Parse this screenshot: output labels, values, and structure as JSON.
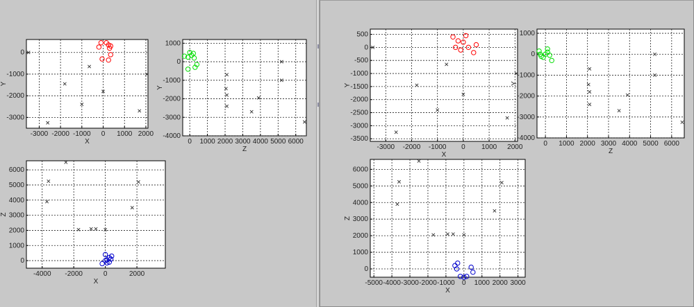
{
  "colors": {
    "background": "#c8c8c8",
    "axes_bg": "#ffffff",
    "grid": "#222222",
    "cross": "#333333",
    "series_xy": "#ff0000",
    "series_zy": "#00dd00",
    "series_xz": "#0000cc"
  },
  "chart_data": [
    {
      "panel": "left",
      "type": "scatter",
      "xlabel": "X",
      "ylabel": "Y",
      "xlim": [
        -3600,
        2100
      ],
      "ylim": [
        -3500,
        600
      ],
      "xticks": [
        -3000,
        -2000,
        -1000,
        0,
        1000,
        2000
      ],
      "xtick_labels": [
        "-3000",
        "-2000",
        "-1000",
        "0",
        "1000",
        "2000"
      ],
      "yticks": [
        -3000,
        -2000,
        -1000,
        0
      ],
      "ytick_labels": [
        "-3000",
        "-2000",
        "-1000",
        "0"
      ],
      "grid": true,
      "series": [
        {
          "marker": "x",
          "points": [
            [
              -3500,
              0
            ],
            [
              -2600,
              -3250
            ],
            [
              -1800,
              -1450
            ],
            [
              -1000,
              -2400
            ],
            [
              -650,
              -650
            ],
            [
              0,
              -1800
            ],
            [
              1700,
              -2700
            ],
            [
              2050,
              -1000
            ]
          ]
        },
        {
          "marker": "o",
          "color": "#ff0000",
          "points": [
            [
              -200,
              250
            ],
            [
              -100,
              450
            ],
            [
              150,
              450
            ],
            [
              250,
              350
            ],
            [
              350,
              300
            ],
            [
              300,
              200
            ],
            [
              350,
              -100
            ],
            [
              250,
              -350
            ],
            [
              -50,
              -300
            ]
          ]
        }
      ]
    },
    {
      "panel": "left",
      "type": "scatter",
      "xlabel": "Z",
      "ylabel": "Y",
      "xlim": [
        -400,
        6600
      ],
      "ylim": [
        -4000,
        1200
      ],
      "xticks": [
        0,
        1000,
        2000,
        3000,
        4000,
        5000,
        6000
      ],
      "xtick_labels": [
        "0",
        "1000",
        "2000",
        "3000",
        "4000",
        "5000",
        "6000"
      ],
      "yticks": [
        -4000,
        -3000,
        -2000,
        -1000,
        0,
        1000
      ],
      "ytick_labels": [
        "-4000",
        "-3000",
        "-2000",
        "-1000",
        "0",
        "1000"
      ],
      "grid": true,
      "series": [
        {
          "marker": "x",
          "points": [
            [
              2100,
              -700
            ],
            [
              2050,
              -1450
            ],
            [
              2100,
              -1800
            ],
            [
              2100,
              -2400
            ],
            [
              3500,
              -2700
            ],
            [
              3900,
              -1950
            ],
            [
              5200,
              0
            ],
            [
              5200,
              -1000
            ],
            [
              6500,
              -3250
            ]
          ]
        },
        {
          "marker": "o",
          "color": "#00dd00",
          "points": [
            [
              -300,
              300
            ],
            [
              -100,
              250
            ],
            [
              0,
              500
            ],
            [
              100,
              350
            ],
            [
              200,
              450
            ],
            [
              250,
              200
            ],
            [
              -100,
              -400
            ],
            [
              300,
              -300
            ],
            [
              400,
              -150
            ]
          ]
        }
      ]
    },
    {
      "panel": "left",
      "type": "scatter",
      "xlabel": "X",
      "ylabel": "Z",
      "xlim": [
        -5000,
        3800
      ],
      "ylim": [
        -500,
        6600
      ],
      "xticks": [
        -4000,
        -2000,
        0,
        2000
      ],
      "xtick_labels": [
        "-4000",
        "-2000",
        "0",
        "2000"
      ],
      "yticks": [
        0,
        1000,
        2000,
        3000,
        4000,
        5000,
        6000
      ],
      "ytick_labels": [
        "0",
        "1000",
        "2000",
        "3000",
        "4000",
        "5000",
        "6000"
      ],
      "grid": true,
      "series": [
        {
          "marker": "x",
          "points": [
            [
              -3600,
              5250
            ],
            [
              -3700,
              3900
            ],
            [
              -2500,
              6500
            ],
            [
              -1700,
              2050
            ],
            [
              -900,
              2100
            ],
            [
              -600,
              2100
            ],
            [
              0,
              2050
            ],
            [
              1700,
              3500
            ],
            [
              2100,
              5200
            ]
          ]
        },
        {
          "marker": "o",
          "color": "#0000cc",
          "points": [
            [
              -200,
              -200
            ],
            [
              0,
              400
            ],
            [
              0,
              0
            ],
            [
              100,
              50
            ],
            [
              250,
              -100
            ],
            [
              350,
              100
            ],
            [
              400,
              300
            ],
            [
              250,
              200
            ],
            [
              100,
              -150
            ]
          ]
        }
      ]
    },
    {
      "panel": "right",
      "type": "scatter",
      "xlabel": "X",
      "ylabel": "Y",
      "xlim": [
        -3600,
        2100
      ],
      "ylim": [
        -3600,
        700
      ],
      "xticks": [
        -3000,
        -2000,
        -1000,
        0,
        1000,
        2000
      ],
      "xtick_labels": [
        "-3000",
        "-2000",
        "-1000",
        "0",
        "1000",
        "2000"
      ],
      "yticks": [
        -3500,
        -3000,
        -2500,
        -2000,
        -1500,
        -1000,
        -500,
        0,
        500
      ],
      "ytick_labels": [
        "-3500",
        "-3000",
        "-2500",
        "-2000",
        "-1500",
        "-1000",
        "-500",
        "0",
        "500"
      ],
      "grid": true,
      "series": [
        {
          "marker": "x",
          "points": [
            [
              -3500,
              0
            ],
            [
              -2600,
              -3250
            ],
            [
              -1800,
              -1450
            ],
            [
              -1000,
              -2400
            ],
            [
              -650,
              -650
            ],
            [
              0,
              -1800
            ],
            [
              1700,
              -2700
            ],
            [
              2050,
              -1000
            ]
          ]
        },
        {
          "marker": "o",
          "color": "#ff0000",
          "points": [
            [
              -400,
              400
            ],
            [
              -300,
              0
            ],
            [
              -200,
              250
            ],
            [
              -100,
              -100
            ],
            [
              0,
              200
            ],
            [
              100,
              450
            ],
            [
              200,
              0
            ],
            [
              400,
              -200
            ],
            [
              500,
              100
            ]
          ]
        }
      ]
    },
    {
      "panel": "right",
      "type": "scatter",
      "xlabel": "Z",
      "ylabel": "Y",
      "xlim": [
        -400,
        6600
      ],
      "ylim": [
        -4000,
        1200
      ],
      "xticks": [
        0,
        1000,
        2000,
        3000,
        4000,
        5000,
        6000
      ],
      "xtick_labels": [
        "0",
        "1000",
        "2000",
        "3000",
        "4000",
        "5000",
        "6000"
      ],
      "yticks": [
        -4000,
        -3000,
        -2000,
        -1000,
        0,
        1000
      ],
      "ytick_labels": [
        "-4000",
        "-3000",
        "-2000",
        "-1000",
        "0",
        "1000"
      ],
      "grid": true,
      "series": [
        {
          "marker": "x",
          "points": [
            [
              2100,
              -700
            ],
            [
              2050,
              -1450
            ],
            [
              2100,
              -1800
            ],
            [
              2100,
              -2400
            ],
            [
              3500,
              -2700
            ],
            [
              3900,
              -1950
            ],
            [
              5200,
              0
            ],
            [
              5200,
              -1000
            ],
            [
              6500,
              -3250
            ]
          ]
        },
        {
          "marker": "o",
          "color": "#00dd00",
          "points": [
            [
              -300,
              150
            ],
            [
              -250,
              0
            ],
            [
              -100,
              -150
            ],
            [
              0,
              0
            ],
            [
              100,
              100
            ],
            [
              200,
              -50
            ],
            [
              300,
              -300
            ],
            [
              100,
              250
            ],
            [
              -200,
              -100
            ]
          ]
        }
      ]
    },
    {
      "panel": "right",
      "type": "scatter",
      "xlabel": "X",
      "ylabel": "Z",
      "xlim": [
        -5200,
        3400
      ],
      "ylim": [
        -500,
        6600
      ],
      "xticks": [
        -5000,
        -4000,
        -3000,
        -2000,
        -1000,
        0,
        1000,
        2000,
        3000
      ],
      "xtick_labels": [
        "-5000",
        "-4000",
        "-3000",
        "-2000",
        "-1000",
        "0",
        "1000",
        "2000",
        "3000"
      ],
      "yticks": [
        0,
        1000,
        2000,
        3000,
        4000,
        5000,
        6000
      ],
      "ytick_labels": [
        "0",
        "1000",
        "2000",
        "3000",
        "4000",
        "5000",
        "6000"
      ],
      "grid": true,
      "series": [
        {
          "marker": "x",
          "points": [
            [
              -3600,
              5250
            ],
            [
              -3700,
              3900
            ],
            [
              -2500,
              6500
            ],
            [
              -1700,
              2050
            ],
            [
              -900,
              2100
            ],
            [
              -600,
              2100
            ],
            [
              0,
              2050
            ],
            [
              1700,
              3500
            ],
            [
              2100,
              5200
            ]
          ]
        },
        {
          "marker": "o",
          "color": "#0000cc",
          "points": [
            [
              -400,
              0
            ],
            [
              -350,
              350
            ],
            [
              -200,
              -450
            ],
            [
              0,
              -500
            ],
            [
              150,
              -450
            ],
            [
              400,
              100
            ],
            [
              500,
              -200
            ],
            [
              -500,
              200
            ]
          ]
        }
      ]
    }
  ]
}
